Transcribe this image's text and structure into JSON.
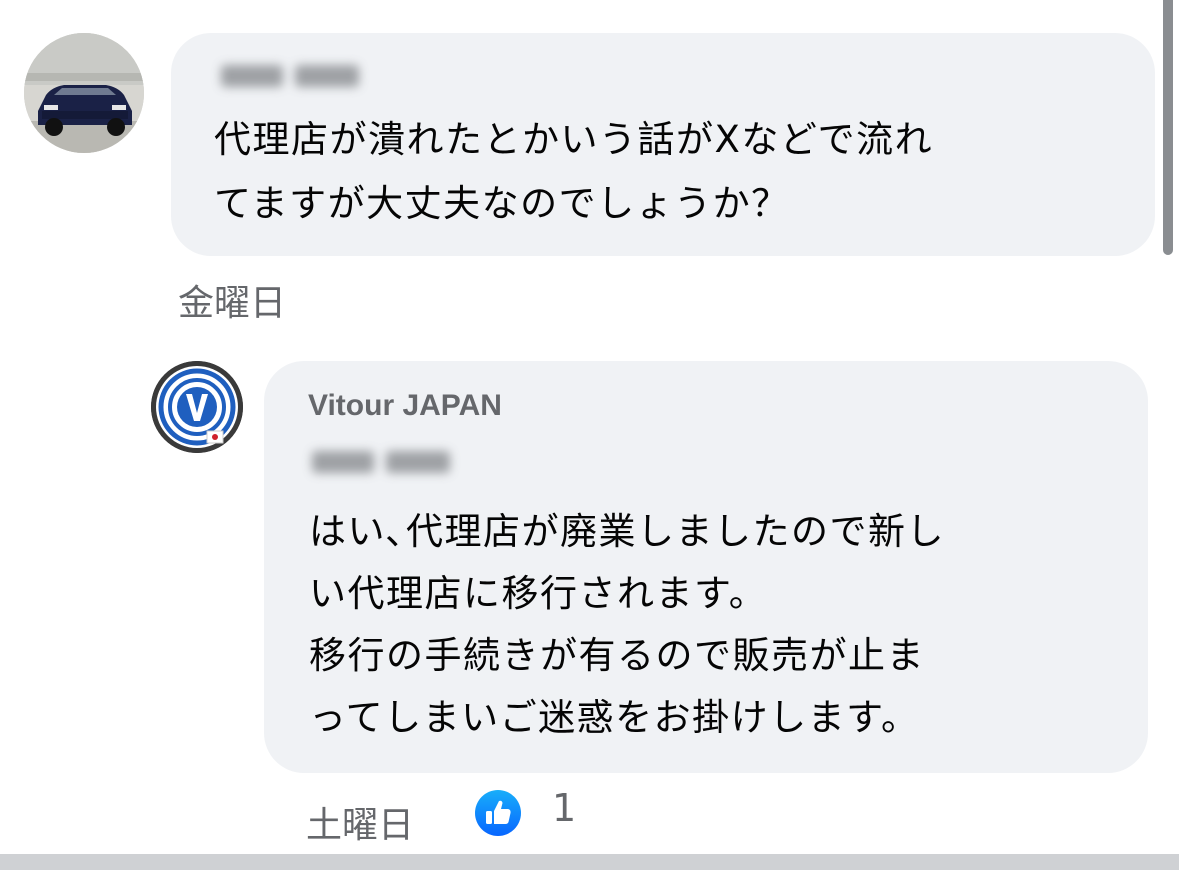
{
  "comments": [
    {
      "message_lines": [
        "代理店が潰れたとかいう話がXなどで流れ",
        "てますが大丈夫なのでしょうか？"
      ],
      "time": "金曜日"
    },
    {
      "author": "Vitour JAPAN",
      "message_lines": [
        "はい､代理店が廃業しましたので新し",
        "い代理店に移行されます。",
        "移行の手続きが有るので販売が止ま",
        "ってしまいご迷惑をお掛けします。"
      ],
      "time": "土曜日",
      "reaction_icon": "thumbs-up-icon",
      "reaction_count": "1"
    }
  ],
  "icons": {
    "commenter_avatar": "car-photo-avatar",
    "page_avatar": "vitour-logo-avatar",
    "reaction": "thumbs-up-icon"
  },
  "colors": {
    "bubble_bg": "#f0f2f5",
    "secondary_text": "#65676b",
    "like_blue": "#1877f2",
    "brand_blue": "#1f5fbf"
  }
}
